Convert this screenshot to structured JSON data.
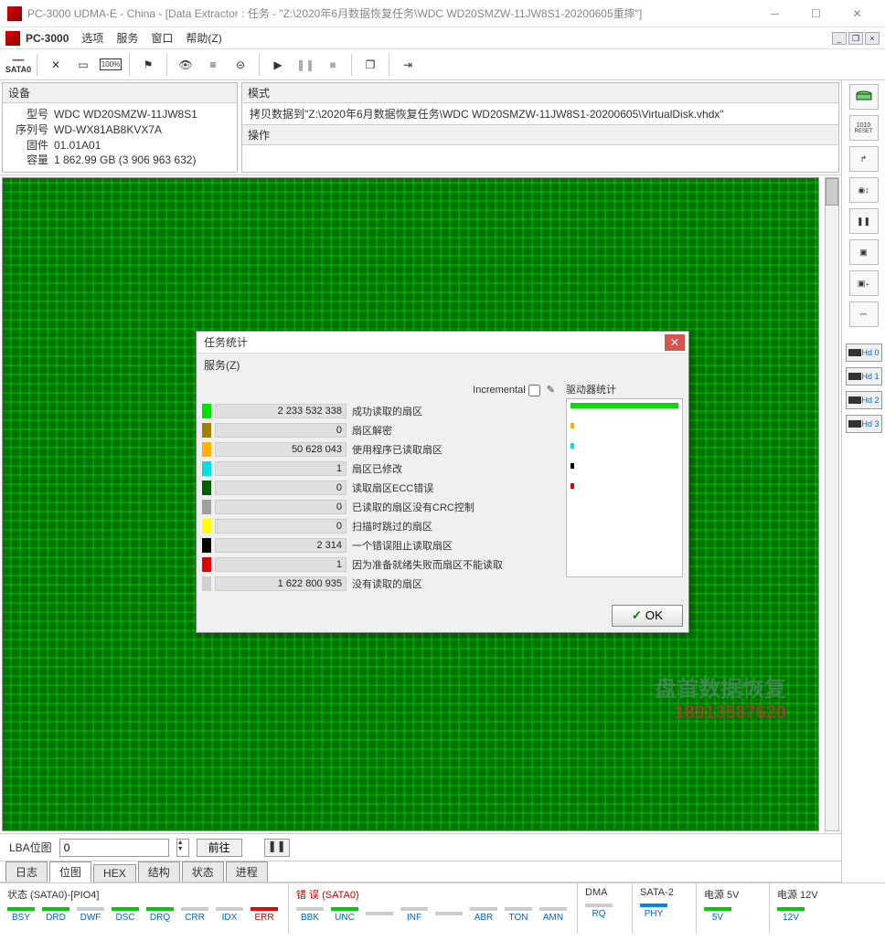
{
  "window": {
    "title": "PC-3000 UDMA-E - China - [Data Extractor : 任务 - \"Z:\\2020年6月数据恢复任务\\WDC WD20SMZW-11JW8S1-20200605重摔\"]"
  },
  "menubar": {
    "app": "PC-3000",
    "items": [
      "选项",
      "服务",
      "窗口",
      "帮助(Z)"
    ]
  },
  "toolbar": {
    "sata": "SATA0"
  },
  "device_panel": {
    "title": "设备",
    "model_k": "型号",
    "model_v": "WDC WD20SMZW-11JW8S1",
    "serial_k": "序列号",
    "serial_v": "WD-WX81AB8KVX7A",
    "fw_k": "固件",
    "fw_v": "01.01A01",
    "cap_k": "容量",
    "cap_v": "1 862.99 GB (3 906 963 632)"
  },
  "mode_panel": {
    "title": "模式",
    "line": "拷贝数据到\"Z:\\2020年6月数据恢复任务\\WDC WD20SMZW-11JW8S1-20200605\\VirtualDisk.vhdx\"",
    "op_title": "操作"
  },
  "dialog": {
    "title": "任务统计",
    "menu": "服务(Z)",
    "incremental": "Incremental",
    "drv_title": "驱动器统计",
    "ok": "OK",
    "rows": [
      {
        "color": "#00e000",
        "value": "2 233 532 338",
        "label": "成功读取的扇区"
      },
      {
        "color": "#a08000",
        "value": "0",
        "label": "扇区解密"
      },
      {
        "color": "#ffb000",
        "value": "50 628 043",
        "label": "使用程序已读取扇区"
      },
      {
        "color": "#00e0e0",
        "value": "1",
        "label": "扇区已修改"
      },
      {
        "color": "#006000",
        "value": "0",
        "label": "读取扇区ECC错误"
      },
      {
        "color": "#a0a0a0",
        "value": "0",
        "label": "已读取的扇区没有CRC控制"
      },
      {
        "color": "#ffff00",
        "value": "0",
        "label": "扫描时跳过的扇区"
      },
      {
        "color": "#000000",
        "value": "2 314",
        "label": "一个错误阻止读取扇区"
      },
      {
        "color": "#e00000",
        "value": "1",
        "label": "因为准备就绪失败而扇区不能读取"
      },
      {
        "color": "#d0d0d0",
        "value": "1 622 800 935",
        "label": "没有读取的扇区"
      }
    ],
    "drv_bars": [
      {
        "color": "#00e000",
        "w": 100
      },
      {
        "color": "#ffb000",
        "w": 3
      },
      {
        "color": "#00e0e0",
        "w": 3
      },
      {
        "color": "#000000",
        "w": 3
      },
      {
        "color": "#e00000",
        "w": 3
      }
    ]
  },
  "bottom": {
    "lba_label": "LBA位图",
    "lba_value": "0",
    "go": "前往"
  },
  "tabs": [
    "日志",
    "位图",
    "HEX",
    "结构",
    "状态",
    "进程"
  ],
  "active_tab": 1,
  "status": {
    "g1_title": "状态 (SATA0)-[PIO4]",
    "g1_flags": [
      {
        "t": "BSY",
        "c": "green",
        "tc": "blue-t"
      },
      {
        "t": "DRD",
        "c": "green",
        "tc": "blue-t"
      },
      {
        "t": "DWF",
        "c": "gray",
        "tc": "blue-t"
      },
      {
        "t": "DSC",
        "c": "green",
        "tc": "blue-t"
      },
      {
        "t": "DRQ",
        "c": "green",
        "tc": "blue-t"
      },
      {
        "t": "CRR",
        "c": "gray",
        "tc": "blue-t"
      },
      {
        "t": "IDX",
        "c": "gray",
        "tc": "blue-t"
      },
      {
        "t": "ERR",
        "c": "red",
        "tc": "red-t"
      }
    ],
    "g2_title": "错 误 (SATA0)",
    "g2_flags": [
      {
        "t": "BBK",
        "c": "gray",
        "tc": "blue-t"
      },
      {
        "t": "UNC",
        "c": "green",
        "tc": "blue-t"
      },
      {
        "t": "",
        "c": "gray",
        "tc": ""
      },
      {
        "t": "INF",
        "c": "gray",
        "tc": "blue-t"
      },
      {
        "t": "",
        "c": "gray",
        "tc": ""
      },
      {
        "t": "ABR",
        "c": "gray",
        "tc": "blue-t"
      },
      {
        "t": "TON",
        "c": "gray",
        "tc": "blue-t"
      },
      {
        "t": "AMN",
        "c": "gray",
        "tc": "blue-t"
      }
    ],
    "g3_title": "DMA",
    "g3_flag": {
      "t": "RQ",
      "c": "gray",
      "tc": "blue-t"
    },
    "g4_title": "SATA-2",
    "g4_flag": {
      "t": "PHY",
      "c": "blue",
      "tc": "blue-t"
    },
    "g5_title": "电源 5V",
    "g5_flag": {
      "t": "5V",
      "c": "green",
      "tc": "blue-t"
    },
    "g6_title": "电源 12V",
    "g6_flag": {
      "t": "12V",
      "c": "green",
      "tc": "blue-t"
    }
  },
  "side_hd": [
    "Hd 0",
    "Hd 1",
    "Hd 2",
    "Hd 3"
  ],
  "watermark": {
    "w1": "盘首数据恢复",
    "w2": "18913587620"
  }
}
